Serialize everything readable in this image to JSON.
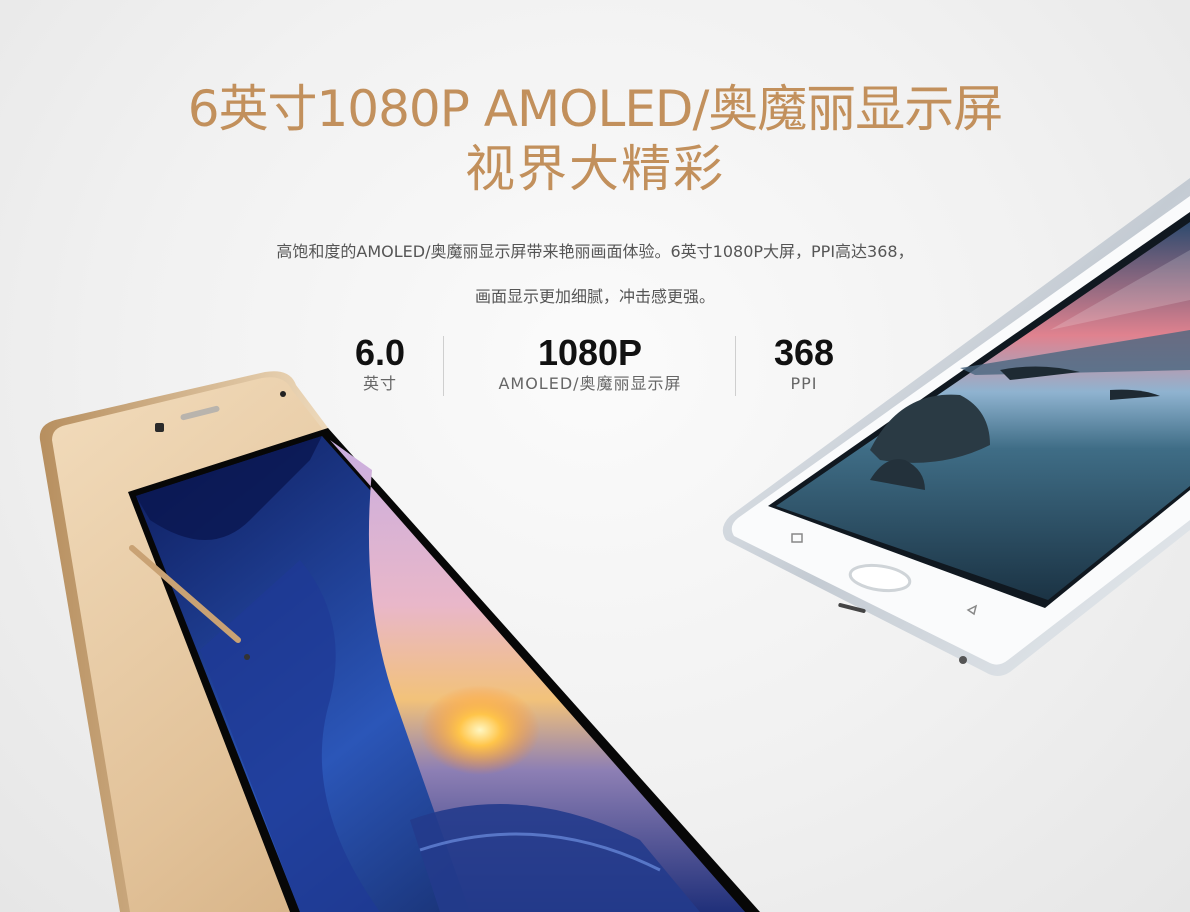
{
  "colors": {
    "accent": "#c2905c",
    "text": "#111111",
    "subtext": "#666666"
  },
  "headline": {
    "line1": "6英寸1080P AMOLED/奥魔丽显示屏",
    "line2": "视界大精彩"
  },
  "description": {
    "line1": "高饱和度的AMOLED/奥魔丽显示屏带来艳丽画面体验。6英寸1080P大屏，PPI高达368，",
    "line2": "画面显示更加细腻，冲击感更强。"
  },
  "specs": [
    {
      "value": "6.0",
      "label": "英寸"
    },
    {
      "value": "1080P",
      "label": "AMOLED/奥魔丽显示屏"
    },
    {
      "value": "368",
      "label": "PPI"
    }
  ],
  "images": [
    {
      "name": "gold-phone",
      "description": "gold smartphone with sunset sea wallpaper"
    },
    {
      "name": "white-phone",
      "description": "white smartphone with twilight lake wallpaper"
    }
  ]
}
